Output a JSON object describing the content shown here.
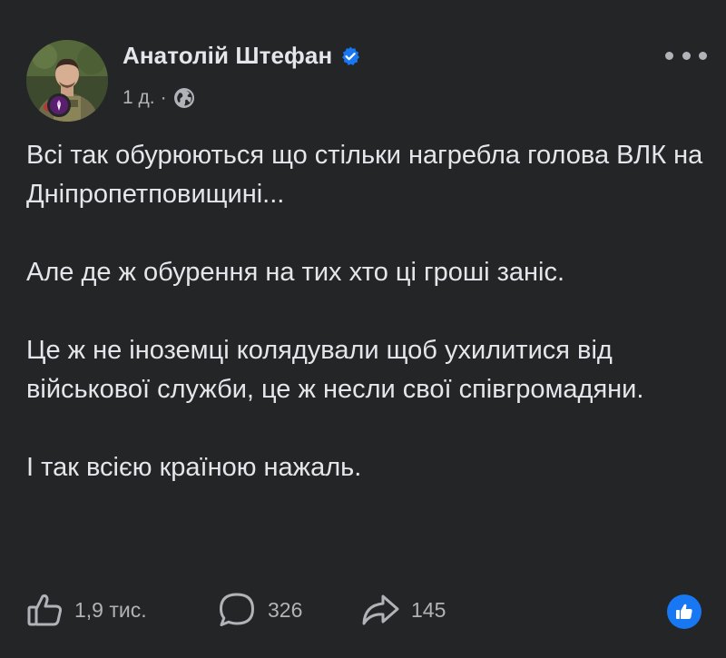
{
  "post": {
    "author": {
      "name": "Анатолій Штефан",
      "verified": true,
      "avatar_icon": "profile-photo-icon"
    },
    "meta": {
      "time": "1 д.",
      "separator": "·",
      "audience_icon": "globe-icon"
    },
    "menu_icon": "more-horizontal-icon",
    "paragraphs": [
      "Всі так обурюються що стільки нагребла голова ВЛК на Дніпропетповищині...",
      "Але де ж обурення на тих хто ці гроші заніс.",
      "Це ж не іноземці колядували щоб ухилитися від військової служби, це ж несли свої співгромадяни.",
      "І так всією країною нажаль."
    ],
    "actions": {
      "likes": "1,9 тис.",
      "comments": "326",
      "shares": "145"
    },
    "colors": {
      "background": "#242526",
      "primary_text": "#e4e6eb",
      "secondary_text": "#b0b3b8",
      "accent": "#1877f2"
    }
  }
}
